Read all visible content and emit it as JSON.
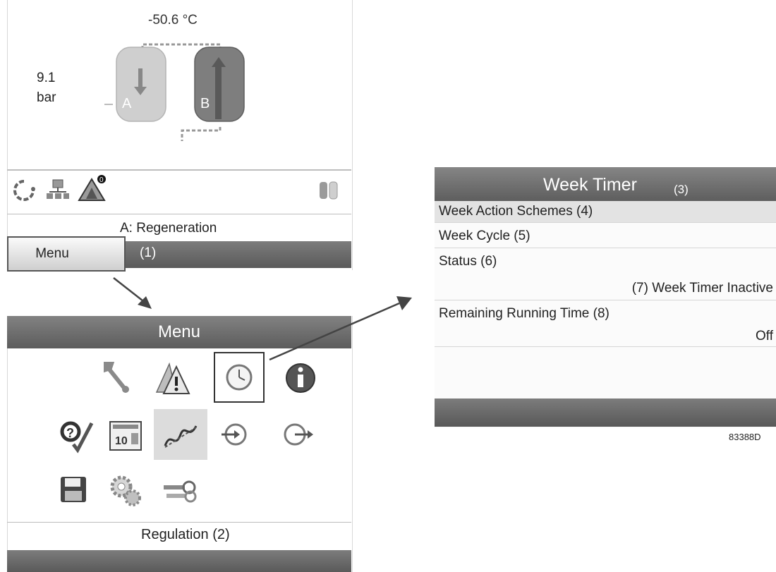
{
  "main_screen": {
    "temperature": "-50.6 °C",
    "pressure_value": "9.1",
    "pressure_unit": "bar",
    "vessel_a_label": "A",
    "vessel_b_label": "B",
    "alarm_count": "0",
    "status_text": "A: Regeneration",
    "menu_button_label": "Menu",
    "callout_menu": "(1)",
    "status_icons": [
      "refresh-icon",
      "network-icon",
      "alarm-warning-icon",
      "dryer-vessels-icon"
    ]
  },
  "menu_screen": {
    "title": "Menu",
    "icons": [
      "wrench-icon",
      "warning-triangles-icon",
      "clock-icon",
      "info-icon",
      "service-check-icon",
      "counter-icon",
      "regulation-icon",
      "input-icon",
      "output-icon",
      "save-icon",
      "settings-gears-icon",
      "access-keys-icon"
    ],
    "selected_label": "Regulation",
    "callout_selected": "(2)"
  },
  "week_timer": {
    "title": "Week Timer",
    "callout_title": "(3)",
    "rows": [
      {
        "label": "Week Action Schemes",
        "callout": "(4)"
      },
      {
        "label": "Week Cycle",
        "callout": "(5)"
      },
      {
        "label": "Status",
        "callout": "(6)",
        "value": "Week Timer Inactive",
        "value_callout": "(7)"
      },
      {
        "label": "Remaining Running Time",
        "callout": "(8)",
        "value": "Off"
      }
    ]
  },
  "figure_number": "83388D",
  "colors": {
    "header_gray": "#6b6b6b",
    "selection_frame": "#333333",
    "vessel_a": "#c8c8c8",
    "vessel_b": "#7a7a7a"
  }
}
